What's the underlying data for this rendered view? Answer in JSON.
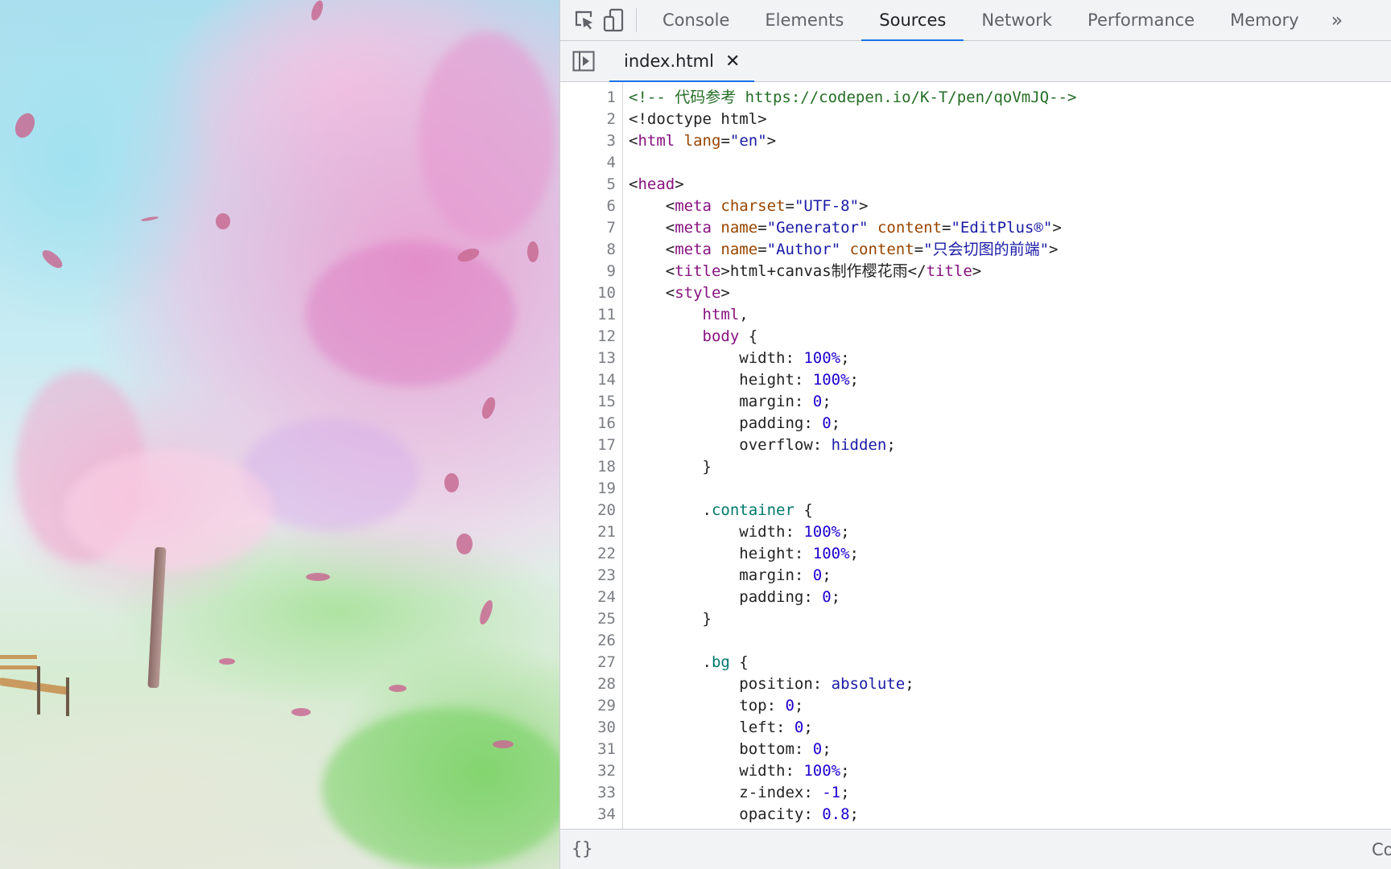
{
  "devtools": {
    "toolbar": {
      "inspect_icon": "inspect-element-icon",
      "device_icon": "device-toolbar-icon",
      "tabs": [
        {
          "label": "Console",
          "active": false
        },
        {
          "label": "Elements",
          "active": false
        },
        {
          "label": "Sources",
          "active": true
        },
        {
          "label": "Network",
          "active": false
        },
        {
          "label": "Performance",
          "active": false
        },
        {
          "label": "Memory",
          "active": false
        }
      ],
      "more_label": "»"
    },
    "filebar": {
      "navigator_toggle_icon": "toggle-navigator-icon",
      "open_file": "index.html",
      "close_label": "✕"
    },
    "editor": {
      "lines": [
        [
          {
            "t": "comment",
            "s": "<!-- 代码参考 https://codepen.io/K-T/pen/qoVmJQ-->"
          }
        ],
        [
          {
            "t": "text",
            "s": "<!doctype html>"
          }
        ],
        [
          {
            "t": "text",
            "s": "<"
          },
          {
            "t": "tag",
            "s": "html"
          },
          {
            "t": "text",
            "s": " "
          },
          {
            "t": "attr",
            "s": "lang"
          },
          {
            "t": "text",
            "s": "="
          },
          {
            "t": "val",
            "s": "\"en\""
          },
          {
            "t": "text",
            "s": ">"
          }
        ],
        [],
        [
          {
            "t": "text",
            "s": "<"
          },
          {
            "t": "tag",
            "s": "head"
          },
          {
            "t": "text",
            "s": ">"
          }
        ],
        [
          {
            "t": "text",
            "s": "    <"
          },
          {
            "t": "tag",
            "s": "meta"
          },
          {
            "t": "text",
            "s": " "
          },
          {
            "t": "attr",
            "s": "charset"
          },
          {
            "t": "text",
            "s": "="
          },
          {
            "t": "val",
            "s": "\"UTF-8\""
          },
          {
            "t": "text",
            "s": ">"
          }
        ],
        [
          {
            "t": "text",
            "s": "    <"
          },
          {
            "t": "tag",
            "s": "meta"
          },
          {
            "t": "text",
            "s": " "
          },
          {
            "t": "attr",
            "s": "name"
          },
          {
            "t": "text",
            "s": "="
          },
          {
            "t": "val",
            "s": "\"Generator\""
          },
          {
            "t": "text",
            "s": " "
          },
          {
            "t": "attr",
            "s": "content"
          },
          {
            "t": "text",
            "s": "="
          },
          {
            "t": "val",
            "s": "\"EditPlus®\""
          },
          {
            "t": "text",
            "s": ">"
          }
        ],
        [
          {
            "t": "text",
            "s": "    <"
          },
          {
            "t": "tag",
            "s": "meta"
          },
          {
            "t": "text",
            "s": " "
          },
          {
            "t": "attr",
            "s": "name"
          },
          {
            "t": "text",
            "s": "="
          },
          {
            "t": "val",
            "s": "\"Author\""
          },
          {
            "t": "text",
            "s": " "
          },
          {
            "t": "attr",
            "s": "content"
          },
          {
            "t": "text",
            "s": "="
          },
          {
            "t": "val",
            "s": "\"只会切图的前端\""
          },
          {
            "t": "text",
            "s": ">"
          }
        ],
        [
          {
            "t": "text",
            "s": "    <"
          },
          {
            "t": "tag",
            "s": "title"
          },
          {
            "t": "text",
            "s": ">html+canvas制作樱花雨</"
          },
          {
            "t": "tag",
            "s": "title"
          },
          {
            "t": "text",
            "s": ">"
          }
        ],
        [
          {
            "t": "text",
            "s": "    <"
          },
          {
            "t": "tag",
            "s": "style"
          },
          {
            "t": "text",
            "s": ">"
          }
        ],
        [
          {
            "t": "text",
            "s": "        "
          },
          {
            "t": "sel",
            "s": "html"
          },
          {
            "t": "text",
            "s": ","
          }
        ],
        [
          {
            "t": "text",
            "s": "        "
          },
          {
            "t": "sel",
            "s": "body"
          },
          {
            "t": "text",
            "s": " {"
          }
        ],
        [
          {
            "t": "text",
            "s": "            width: "
          },
          {
            "t": "num",
            "s": "100%"
          },
          {
            "t": "text",
            "s": ";"
          }
        ],
        [
          {
            "t": "text",
            "s": "            height: "
          },
          {
            "t": "num",
            "s": "100%"
          },
          {
            "t": "text",
            "s": ";"
          }
        ],
        [
          {
            "t": "text",
            "s": "            margin: "
          },
          {
            "t": "num",
            "s": "0"
          },
          {
            "t": "text",
            "s": ";"
          }
        ],
        [
          {
            "t": "text",
            "s": "            padding: "
          },
          {
            "t": "num",
            "s": "0"
          },
          {
            "t": "text",
            "s": ";"
          }
        ],
        [
          {
            "t": "text",
            "s": "            overflow: "
          },
          {
            "t": "kw",
            "s": "hidden"
          },
          {
            "t": "text",
            "s": ";"
          }
        ],
        [
          {
            "t": "text",
            "s": "        }"
          }
        ],
        [],
        [
          {
            "t": "text",
            "s": "        ."
          },
          {
            "t": "cls",
            "s": "container"
          },
          {
            "t": "text",
            "s": " {"
          }
        ],
        [
          {
            "t": "text",
            "s": "            width: "
          },
          {
            "t": "num",
            "s": "100%"
          },
          {
            "t": "text",
            "s": ";"
          }
        ],
        [
          {
            "t": "text",
            "s": "            height: "
          },
          {
            "t": "num",
            "s": "100%"
          },
          {
            "t": "text",
            "s": ";"
          }
        ],
        [
          {
            "t": "text",
            "s": "            margin: "
          },
          {
            "t": "num",
            "s": "0"
          },
          {
            "t": "text",
            "s": ";"
          }
        ],
        [
          {
            "t": "text",
            "s": "            padding: "
          },
          {
            "t": "num",
            "s": "0"
          },
          {
            "t": "text",
            "s": ";"
          }
        ],
        [
          {
            "t": "text",
            "s": "        }"
          }
        ],
        [],
        [
          {
            "t": "text",
            "s": "        ."
          },
          {
            "t": "cls",
            "s": "bg"
          },
          {
            "t": "text",
            "s": " {"
          }
        ],
        [
          {
            "t": "text",
            "s": "            position: "
          },
          {
            "t": "kw",
            "s": "absolute"
          },
          {
            "t": "text",
            "s": ";"
          }
        ],
        [
          {
            "t": "text",
            "s": "            top: "
          },
          {
            "t": "num",
            "s": "0"
          },
          {
            "t": "text",
            "s": ";"
          }
        ],
        [
          {
            "t": "text",
            "s": "            left: "
          },
          {
            "t": "num",
            "s": "0"
          },
          {
            "t": "text",
            "s": ";"
          }
        ],
        [
          {
            "t": "text",
            "s": "            bottom: "
          },
          {
            "t": "num",
            "s": "0"
          },
          {
            "t": "text",
            "s": ";"
          }
        ],
        [
          {
            "t": "text",
            "s": "            width: "
          },
          {
            "t": "num",
            "s": "100%"
          },
          {
            "t": "text",
            "s": ";"
          }
        ],
        [
          {
            "t": "text",
            "s": "            z-index: "
          },
          {
            "t": "num",
            "s": "-1"
          },
          {
            "t": "text",
            "s": ";"
          }
        ],
        [
          {
            "t": "text",
            "s": "            opacity: "
          },
          {
            "t": "num",
            "s": "0.8"
          },
          {
            "t": "text",
            "s": ";"
          }
        ]
      ]
    },
    "statusbar": {
      "pretty_print_label": "{}",
      "right_text": "Co"
    }
  },
  "preview": {
    "description": "cherry blossom park scene with falling petals, bench and path"
  }
}
